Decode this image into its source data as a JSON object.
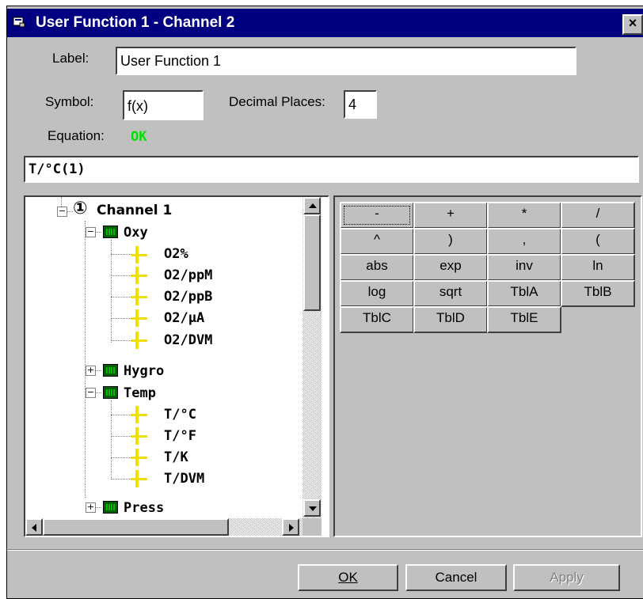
{
  "window": {
    "title": "User Function 1 - Channel 2",
    "close_glyph": "×"
  },
  "form": {
    "label_caption": "Label:",
    "label_value": "User Function 1",
    "symbol_caption": "Symbol:",
    "symbol_value": "f(x)",
    "decimal_caption": "Decimal Places:",
    "decimal_value": "4",
    "equation_caption": "Equation:",
    "equation_status": "OK",
    "equation_text": "T/°C(1)"
  },
  "tree": {
    "channel_label": "Channel 1",
    "channel_marker": "①",
    "groups": [
      {
        "label": "Oxy",
        "expanded": true,
        "items": [
          "O2%",
          "O2/ppM",
          "O2/ppB",
          "O2/µA",
          "O2/DVM"
        ]
      },
      {
        "label": "Hygro",
        "expanded": false,
        "items": []
      },
      {
        "label": "Temp",
        "expanded": true,
        "items": [
          "T/°C",
          "T/°F",
          "T/K",
          "T/DVM"
        ]
      },
      {
        "label": "Press",
        "expanded": false,
        "items": []
      }
    ]
  },
  "calculator": {
    "rows": [
      [
        "-",
        "+",
        "*",
        "/"
      ],
      [
        "^",
        ")",
        ",",
        "("
      ],
      [
        "abs",
        "exp",
        "inv",
        "ln"
      ],
      [
        "log",
        "sqrt",
        "TblA",
        "TblB"
      ],
      [
        "TblC",
        "TblD",
        "TblE"
      ]
    ]
  },
  "buttons": {
    "ok": "OK",
    "cancel": "Cancel",
    "apply": "Apply"
  },
  "colors": {
    "titlebar": "#000080",
    "status_ok": "#00e000",
    "item_icon": "#f0e000",
    "group_icon": "#006000"
  }
}
